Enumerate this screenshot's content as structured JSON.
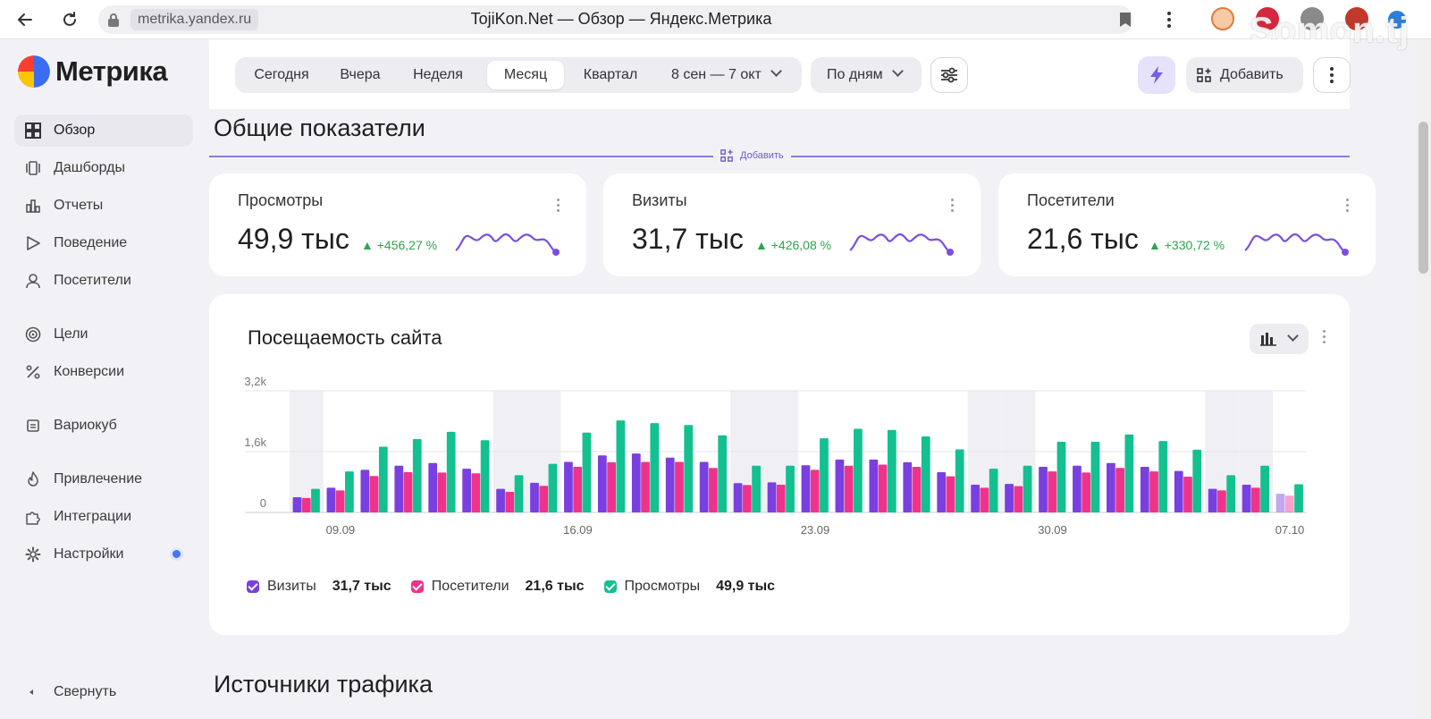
{
  "browser": {
    "url_host": "metrika.yandex.ru",
    "tab_title": "TojiKon.Net — Обзор — Яндекс.Метрика",
    "watermark": "Somon.tj"
  },
  "app": {
    "logo_text": "Метрика"
  },
  "sidebar": {
    "items": [
      {
        "label": "Обзор",
        "icon": "grid-icon",
        "active": true
      },
      {
        "label": "Дашборды",
        "icon": "dashboards-icon"
      },
      {
        "label": "Отчеты",
        "icon": "reports-icon"
      },
      {
        "label": "Поведение",
        "icon": "play-icon"
      },
      {
        "label": "Посетители",
        "icon": "user-icon"
      },
      {
        "label": "Цели",
        "icon": "target-icon"
      },
      {
        "label": "Конверсии",
        "icon": "percent-icon"
      },
      {
        "label": "Вариокуб",
        "icon": "cube-icon"
      },
      {
        "label": "Привлечение",
        "icon": "fire-icon"
      },
      {
        "label": "Интеграции",
        "icon": "puzzle-icon"
      },
      {
        "label": "Настройки",
        "icon": "gear-icon",
        "has_dot": true
      }
    ],
    "collapse_label": "Свернуть"
  },
  "toolbar": {
    "periods": [
      "Сегодня",
      "Вчера",
      "Неделя",
      "Месяц",
      "Квартал"
    ],
    "active_period": "Месяц",
    "date_range": "8 сен — 7 окт",
    "grouping": "По дням",
    "add_label": "Добавить"
  },
  "summary": {
    "title": "Общие показатели",
    "add_label": "Добавить",
    "cards": [
      {
        "label": "Просмотры",
        "value": "49,9 тыс",
        "delta": "+456,27 %"
      },
      {
        "label": "Визиты",
        "value": "31,7 тыс",
        "delta": "+426,08 %"
      },
      {
        "label": "Посетители",
        "value": "21,6 тыс",
        "delta": "+330,72 %"
      }
    ]
  },
  "traffic_card": {
    "title": "Посещаемость сайта",
    "legend": [
      {
        "name": "Визиты",
        "total": "31,7 тыс",
        "color": "#7a3fe0"
      },
      {
        "name": "Посетители",
        "total": "21,6 тыс",
        "color": "#f0338a"
      },
      {
        "name": "Просмотры",
        "total": "49,9 тыс",
        "color": "#13c08f"
      }
    ]
  },
  "chart_data": {
    "type": "bar",
    "ylim": [
      0,
      3200
    ],
    "y_ticks": [
      "0",
      "1,6k",
      "3,2k"
    ],
    "x_tick_labels": [
      "09.09",
      "16.09",
      "23.09",
      "30.09",
      "07.10"
    ],
    "categories": [
      "08.09",
      "09.09",
      "10.09",
      "11.09",
      "12.09",
      "13.09",
      "14.09",
      "15.09",
      "16.09",
      "17.09",
      "18.09",
      "19.09",
      "20.09",
      "21.09",
      "22.09",
      "23.09",
      "24.09",
      "25.09",
      "26.09",
      "27.09",
      "28.09",
      "29.09",
      "30.09",
      "01.10",
      "02.10",
      "03.10",
      "04.10",
      "05.10",
      "06.10",
      "07.10"
    ],
    "weekend_indices": [
      0,
      6,
      7,
      13,
      14,
      20,
      21,
      27,
      28
    ],
    "series": [
      {
        "name": "Визиты",
        "color": "#7a3fe0",
        "values": [
          400,
          650,
          1120,
          1230,
          1300,
          1150,
          620,
          780,
          1330,
          1500,
          1550,
          1440,
          1330,
          770,
          790,
          1240,
          1390,
          1390,
          1320,
          1060,
          730,
          750,
          1200,
          1230,
          1300,
          1200,
          1090,
          620,
          730,
          490
        ]
      },
      {
        "name": "Посетители",
        "color": "#f0338a",
        "values": [
          380,
          580,
          960,
          1060,
          1050,
          1030,
          540,
          700,
          1200,
          1320,
          1330,
          1330,
          1170,
          720,
          730,
          1120,
          1230,
          1260,
          1200,
          950,
          650,
          690,
          1080,
          1050,
          1170,
          1080,
          940,
          580,
          650,
          440
        ]
      },
      {
        "name": "Просмотры",
        "color": "#13c08f",
        "values": [
          620,
          1080,
          1730,
          1930,
          2120,
          1900,
          980,
          1280,
          2100,
          2420,
          2350,
          2300,
          2030,
          1230,
          1230,
          1950,
          2200,
          2170,
          2000,
          1660,
          1150,
          1230,
          1860,
          1860,
          2050,
          1880,
          1650,
          980,
          1230,
          740
        ]
      }
    ],
    "last_day_partial": true
  },
  "sources": {
    "title": "Источники трафика"
  },
  "colors": {
    "accent": "#7a5be3",
    "delta_up": "#2ea44f",
    "background": "#f2f2f6"
  }
}
